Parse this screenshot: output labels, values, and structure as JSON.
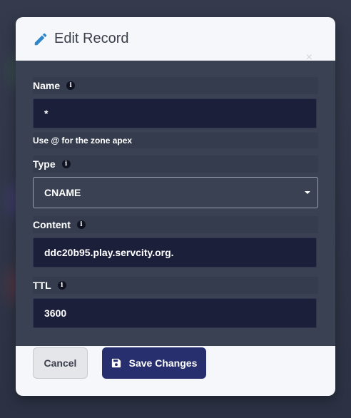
{
  "modal": {
    "title": "Edit Record",
    "icon": "pencil-icon",
    "close_symbol": "×"
  },
  "form": {
    "name": {
      "label": "Name",
      "value": "*",
      "help": "Use @ for the zone apex"
    },
    "type": {
      "label": "Type",
      "selected": "CNAME"
    },
    "content": {
      "label": "Content",
      "value": "ddc20b95.play.servcity.org."
    },
    "ttl": {
      "label": "TTL",
      "value": "3600"
    },
    "info_symbol": "i"
  },
  "buttons": {
    "cancel": "Cancel",
    "save": "Save Changes",
    "save_icon": "floppy-disk-icon"
  },
  "colors": {
    "accent": "#272f6e",
    "pencil": "#2f86c9",
    "field_bg": "#1b1f3a",
    "body_bg": "#3a4152"
  }
}
